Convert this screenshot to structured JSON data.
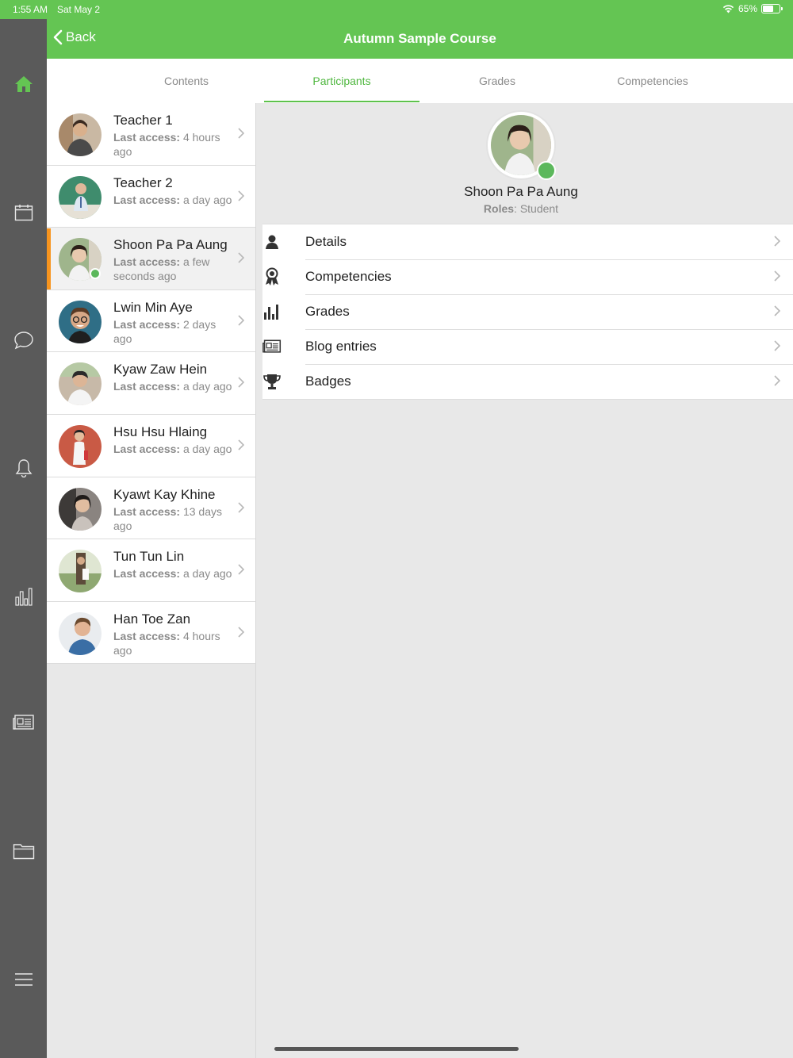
{
  "status_bar": {
    "time": "1:55 AM",
    "date": "Sat May 2",
    "battery": "65%"
  },
  "header": {
    "back_label": "Back",
    "title": "Autumn Sample Course"
  },
  "tabs": [
    {
      "label": "Contents"
    },
    {
      "label": "Participants",
      "active": true
    },
    {
      "label": "Grades"
    },
    {
      "label": "Competencies"
    }
  ],
  "participants": [
    {
      "name": "Teacher 1",
      "access_label": "Last access:",
      "access_value": "4 hours ago"
    },
    {
      "name": "Teacher 2",
      "access_label": "Last access:",
      "access_value": "a day ago"
    },
    {
      "name": "Shoon Pa Pa Aung",
      "access_label": "Last access:",
      "access_value": "a few seconds ago",
      "selected": true,
      "online": true
    },
    {
      "name": "Lwin Min Aye",
      "access_label": "Last access:",
      "access_value": "2 days ago"
    },
    {
      "name": "Kyaw Zaw Hein",
      "access_label": "Last access:",
      "access_value": "a day ago"
    },
    {
      "name": "Hsu Hsu Hlaing",
      "access_label": "Last access:",
      "access_value": "a day ago"
    },
    {
      "name": "Kyawt Kay Khine",
      "access_label": "Last access:",
      "access_value": "13 days ago"
    },
    {
      "name": "Tun Tun Lin",
      "access_label": "Last access:",
      "access_value": "a day ago"
    },
    {
      "name": "Han Toe Zan",
      "access_label": "Last access:",
      "access_value": "4 hours ago"
    }
  ],
  "profile": {
    "name": "Shoon Pa Pa Aung",
    "roles_label": "Roles",
    "roles_value": "Student"
  },
  "menu": [
    {
      "label": "Details",
      "icon": "person-icon"
    },
    {
      "label": "Competencies",
      "icon": "award-ribbon-icon"
    },
    {
      "label": "Grades",
      "icon": "bar-chart-icon"
    },
    {
      "label": "Blog entries",
      "icon": "newspaper-icon"
    },
    {
      "label": "Badges",
      "icon": "trophy-icon"
    }
  ],
  "rail": [
    {
      "icon": "home-icon"
    },
    {
      "icon": "calendar-icon"
    },
    {
      "icon": "chat-bubble-icon"
    },
    {
      "icon": "bell-icon"
    },
    {
      "icon": "bar-chart-icon"
    },
    {
      "icon": "newspaper-icon"
    },
    {
      "icon": "folder-icon"
    },
    {
      "icon": "menu-icon"
    }
  ],
  "colors": {
    "brand": "#64c553",
    "rail": "#5a5a5a",
    "selected_accent": "#f7941d",
    "online": "#5cb85c"
  }
}
